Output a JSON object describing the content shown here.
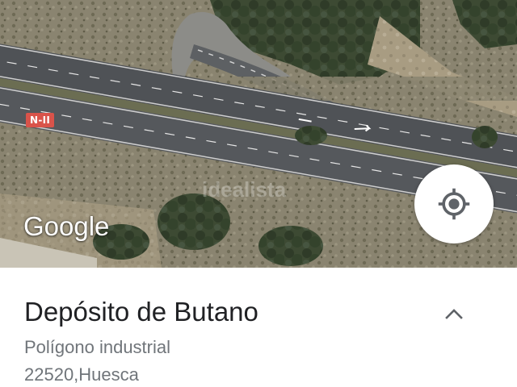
{
  "map": {
    "road_shield_label": "N-II",
    "watermark_text": "idealista",
    "provider_logo": "Google",
    "locate_button_icon": "my-location-icon"
  },
  "place": {
    "title": "Depósito de Butano",
    "category": "Polígono industrial",
    "address": "22520,Huesca",
    "expand_icon": "chevron-up-icon"
  },
  "colors": {
    "road_shield": "#d9534a",
    "title_text": "#202124",
    "secondary_text": "#70757a",
    "icon_gray": "#5f6368"
  }
}
